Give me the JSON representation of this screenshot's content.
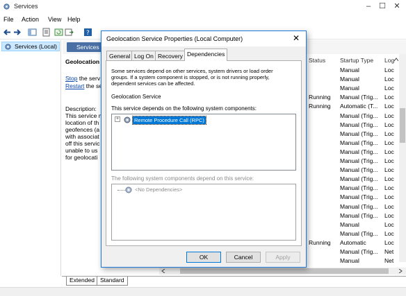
{
  "window": {
    "title": "Services",
    "controls": {
      "minimize": "–",
      "maximize": "☐",
      "close": "✕"
    }
  },
  "menu": [
    "File",
    "Action",
    "View",
    "Help"
  ],
  "tree": {
    "root": "Services (Local)"
  },
  "services_header": "Services",
  "left_pane": {
    "service_name": "Geolocation",
    "stop_link": "Stop",
    "stop_rest": " the serv",
    "restart_link": "Restart",
    "restart_rest": " the se",
    "description_label": "Description:",
    "description_lines": [
      "This service m",
      "location of th",
      "geofences (a",
      "with associat",
      "off this servic",
      "unable to us",
      "for geolocati"
    ]
  },
  "list": {
    "columns": [
      "Status",
      "Startup Type",
      "Log"
    ],
    "rows": [
      {
        "status": "",
        "startup": "Manual",
        "log": "Loc"
      },
      {
        "status": "",
        "startup": "Manual",
        "log": "Loc"
      },
      {
        "status": "",
        "startup": "Manual",
        "log": "Loc"
      },
      {
        "status": "Running",
        "startup": "Manual (Trig...",
        "log": "Loc"
      },
      {
        "status": "Running",
        "startup": "Automatic (T...",
        "log": "Loc"
      },
      {
        "status": "",
        "startup": "Manual (Trig...",
        "log": "Loc"
      },
      {
        "status": "",
        "startup": "Manual (Trig...",
        "log": "Loc"
      },
      {
        "status": "",
        "startup": "Manual (Trig...",
        "log": "Loc"
      },
      {
        "status": "",
        "startup": "Manual (Trig...",
        "log": "Loc"
      },
      {
        "status": "",
        "startup": "Manual (Trig...",
        "log": "Loc"
      },
      {
        "status": "",
        "startup": "Manual (Trig...",
        "log": "Loc"
      },
      {
        "status": "",
        "startup": "Manual (Trig...",
        "log": "Loc"
      },
      {
        "status": "",
        "startup": "Manual (Trig...",
        "log": "Loc"
      },
      {
        "status": "",
        "startup": "Manual (Trig...",
        "log": "Loc"
      },
      {
        "status": "",
        "startup": "Manual (Trig...",
        "log": "Loc"
      },
      {
        "status": "",
        "startup": "Manual (Trig...",
        "log": "Loc"
      },
      {
        "status": "",
        "startup": "Manual (Trig...",
        "log": "Loc"
      },
      {
        "status": "",
        "startup": "Manual",
        "log": "Loc"
      },
      {
        "status": "",
        "startup": "Manual (Trig...",
        "log": "Loc"
      },
      {
        "status": "Running",
        "startup": "Automatic",
        "log": "Loc"
      },
      {
        "status": "",
        "startup": "Manual (Trig...",
        "log": "Net"
      },
      {
        "status": "",
        "startup": "Manual",
        "log": "Net"
      }
    ]
  },
  "bottom_tabs": [
    "Extended",
    "Standard"
  ],
  "dialog": {
    "title": "Geolocation Service Properties (Local Computer)",
    "close": "✕",
    "tabs": [
      "General",
      "Log On",
      "Recovery",
      "Dependencies"
    ],
    "active_tab": "Dependencies",
    "intro_lines": [
      "Some services depend on other services, system drivers or load order",
      "groups. If a system component is stopped, or is not running properly,",
      "dependent services can be affected."
    ],
    "service_name": "Geolocation Service",
    "depends_on_label": "This service depends on the following system components:",
    "depends_on_item": "Remote Procedure Call (RPC)",
    "dependents_label": "The following system components depend on this service:",
    "dependents_item": "<No Dependencies>",
    "buttons": {
      "ok": "OK",
      "cancel": "Cancel",
      "apply": "Apply"
    }
  },
  "colors": {
    "accent": "#0078d7",
    "selection": "#cce8ff",
    "link": "#0645ad"
  }
}
